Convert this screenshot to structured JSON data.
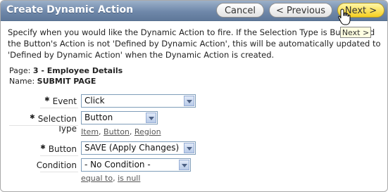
{
  "window": {
    "title": "Create Dynamic Action",
    "buttons": {
      "cancel": "Cancel",
      "previous": "< Previous",
      "next": "Next >"
    },
    "tooltip": "Next >"
  },
  "description": "Specify when you would like the Dynamic Action to fire. If the Selection Type is Button and the Button's Action is not 'Defined by Dynamic Action', this will be automatically updated to 'Defined by Dynamic Action' when the Dynamic Action is created.",
  "meta": {
    "page_label": "Page:",
    "page_value": "3 - Employee Details",
    "name_label": "Name:",
    "name_value": "SUBMIT PAGE"
  },
  "form": {
    "event": {
      "label": "Event",
      "value": "Click"
    },
    "selection_type": {
      "label": "Selection Type",
      "value": "Button",
      "links": [
        "Item",
        "Button",
        "Region"
      ]
    },
    "button": {
      "label": "Button",
      "value": "SAVE (Apply Changes)"
    },
    "condition": {
      "label": "Condition",
      "value": "- No Condition -",
      "links": [
        "equal to",
        "is null"
      ]
    },
    "required_mark": "✱"
  },
  "colors": {
    "title_bar": "#6f88aa",
    "next_button": "#f6cf1f"
  }
}
